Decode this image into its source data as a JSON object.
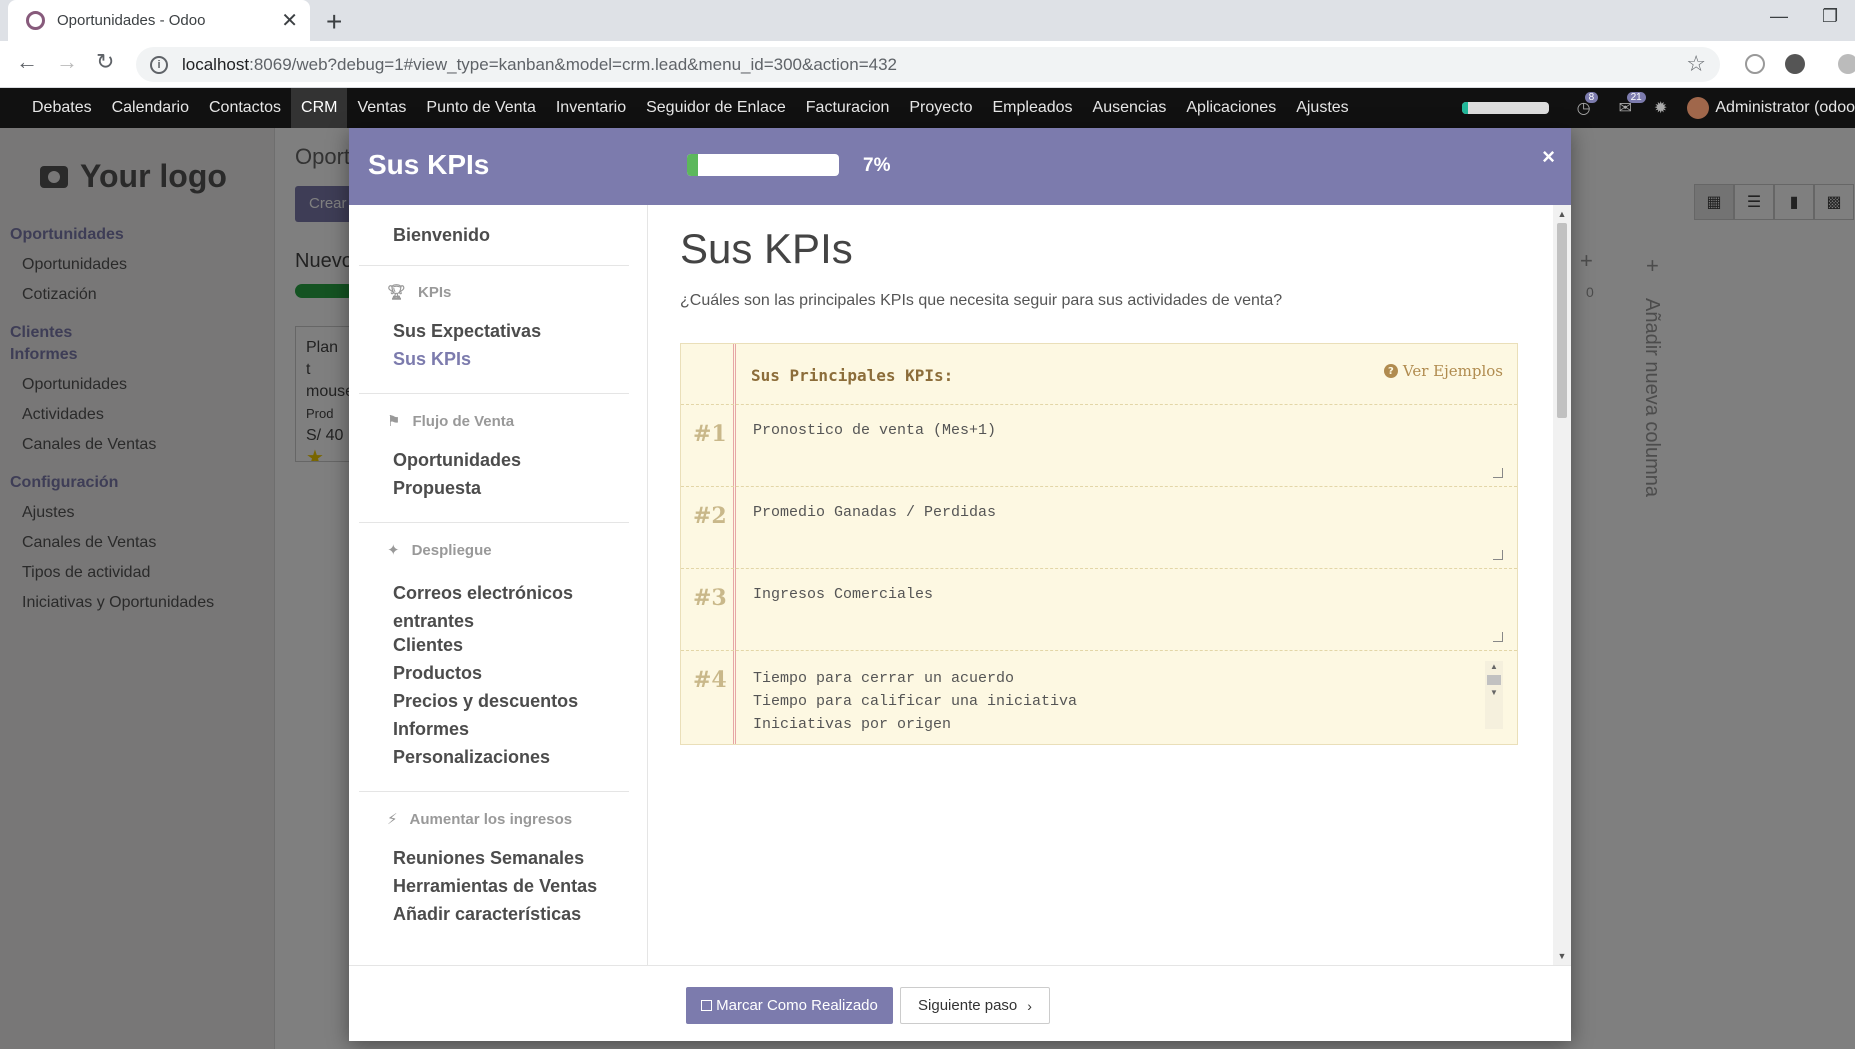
{
  "browser": {
    "tab_title": "Oportunidades - Odoo",
    "tab_close": "✕",
    "new_tab": "+",
    "url_host": "localhost",
    "url_path": ":8069/web?debug=1#view_type=kanban&model=crm.lead&menu_id=300&action=432"
  },
  "odoo_menu": {
    "items": [
      "Debates",
      "Calendario",
      "Contactos",
      "CRM",
      "Ventas",
      "Punto de Venta",
      "Inventario",
      "Seguidor de Enlace",
      "Facturacion",
      "Proyecto",
      "Empleados",
      "Ausencias",
      "Aplicaciones",
      "Ajustes"
    ],
    "active": "CRM",
    "progress_fraction": 0.07,
    "activity_count": "8",
    "message_count": "21",
    "user": "Administrator (odoo"
  },
  "sidebar": {
    "logo_text": "Your logo",
    "sections": [
      {
        "title": "Oportunidades",
        "items": [
          "Oportunidades",
          "Cotización"
        ]
      },
      {
        "title": "Clientes",
        "items": []
      },
      {
        "title": "Informes",
        "items": [
          "Oportunidades",
          "Actividades",
          "Canales de Ventas"
        ]
      },
      {
        "title": "Configuración",
        "items": [
          "Ajustes",
          "Canales de Ventas",
          "Tipos de actividad",
          "Iniciativas y Oportunidades"
        ]
      }
    ]
  },
  "background": {
    "page_title": "Oport",
    "create_label": "Crear",
    "column_title": "Nuevo",
    "card_text": "Plan t mouse",
    "card_tag": "Prod",
    "card_amount": "S/ 40",
    "column_count": "0",
    "add_column": "Añadir nueva columna"
  },
  "modal": {
    "title": "Sus KPIs",
    "progress_fraction": 0.07,
    "progress_label": "7%",
    "close": "×",
    "nav": {
      "welcome": "Bienvenido",
      "groups": [
        {
          "name": "KPIs",
          "steps": [
            "Sus Expectativas",
            "Sus KPIs"
          ]
        },
        {
          "name": "Flujo de Venta",
          "steps": [
            "Oportunidades",
            "Propuesta"
          ]
        },
        {
          "name": "Despliegue",
          "steps": [
            "Correos electrónicos entrantes",
            "Clientes",
            "Productos",
            "Precios y descuentos",
            "Informes",
            "Personalizaciones"
          ]
        },
        {
          "name": "Aumentar los ingresos",
          "steps": [
            "Reuniones Semanales",
            "Herramientas de Ventas",
            "Añadir características"
          ]
        }
      ],
      "current": "Sus KPIs"
    },
    "content": {
      "heading": "Sus KPIs",
      "question": "¿Cuáles son las principales KPIs que necesita seguir para sus actividades de venta?",
      "notepad_title": "Sus Principales KPIs:",
      "examples_link": "Ver Ejemplos",
      "kpis": [
        {
          "num": "#1",
          "text": "Pronostico de venta (Mes+1)"
        },
        {
          "num": "#2",
          "text": "Promedio Ganadas / Perdidas"
        },
        {
          "num": "#3",
          "text": "Ingresos Comerciales"
        },
        {
          "num": "#4",
          "text": "Tiempo para cerrar un acuerdo\nTiempo para calificar una iniciativa\nIniciativas por origen"
        }
      ]
    },
    "footer": {
      "done_label": "Marcar Como Realizado",
      "next_label": "Siguiente paso",
      "next_icon": "›"
    }
  }
}
